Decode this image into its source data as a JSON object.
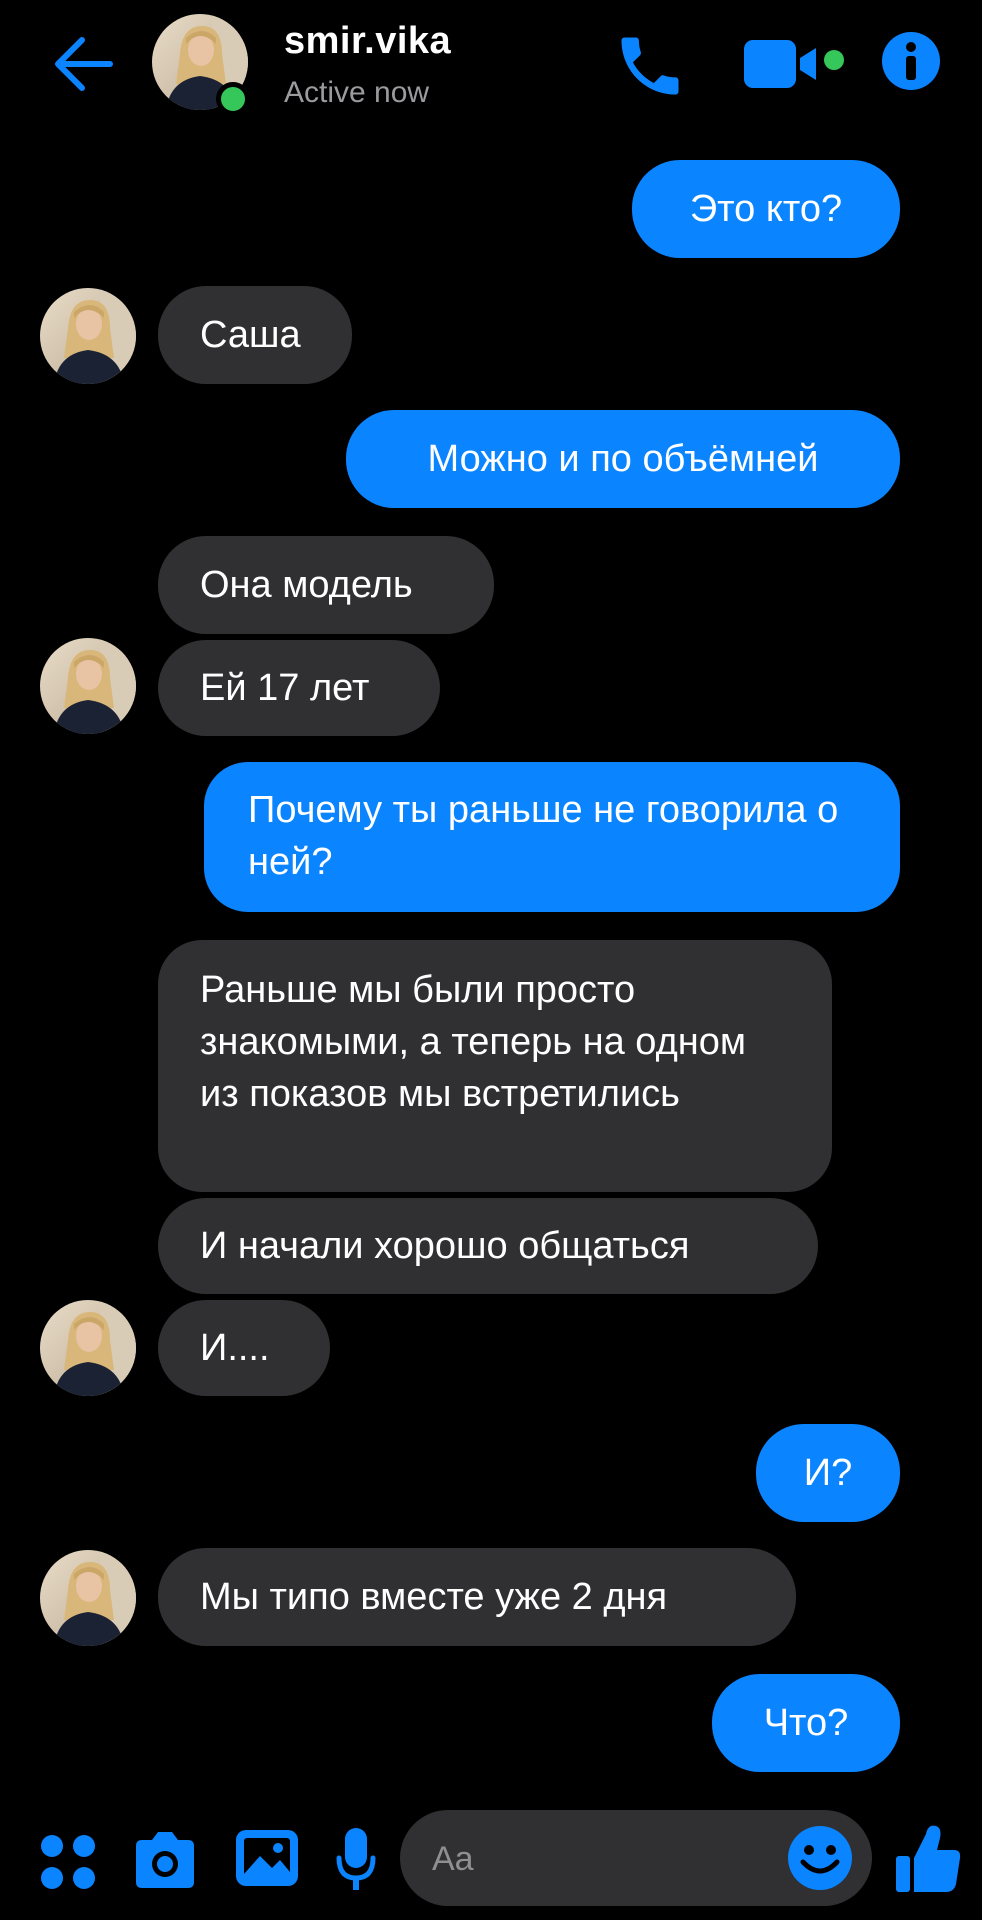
{
  "header": {
    "contact_name": "smir.vika",
    "status": "Active now"
  },
  "messages": [
    {
      "side": "out",
      "text": "Это кто?"
    },
    {
      "side": "in",
      "text": "Саша"
    },
    {
      "side": "out",
      "text": "Можно и по объёмней"
    },
    {
      "side": "in",
      "text": "Она модель"
    },
    {
      "side": "in",
      "text": "Ей 17 лет"
    },
    {
      "side": "out",
      "text": "Почему ты раньше не говорила о ней?"
    },
    {
      "side": "in",
      "text": "Раньше мы были просто знакомыми, а теперь на одном из показов мы встретились"
    },
    {
      "side": "in",
      "text": "И начали хорошо общаться"
    },
    {
      "side": "in",
      "text": "И...."
    },
    {
      "side": "out",
      "text": "И?"
    },
    {
      "side": "in",
      "text": "Мы типо вместе уже 2 дня"
    },
    {
      "side": "out",
      "text": "Что?"
    }
  ],
  "composer": {
    "placeholder": "Aa"
  },
  "icons": [
    "back-arrow-icon",
    "phone-icon",
    "video-camera-icon",
    "info-icon",
    "apps-icon",
    "camera-icon",
    "gallery-icon",
    "microphone-icon",
    "emoji-icon",
    "thumbs-up-icon"
  ],
  "colors": {
    "accent": "#0a84ff",
    "incoming_bubble": "#303032",
    "background": "#000000",
    "online": "#35c759"
  }
}
